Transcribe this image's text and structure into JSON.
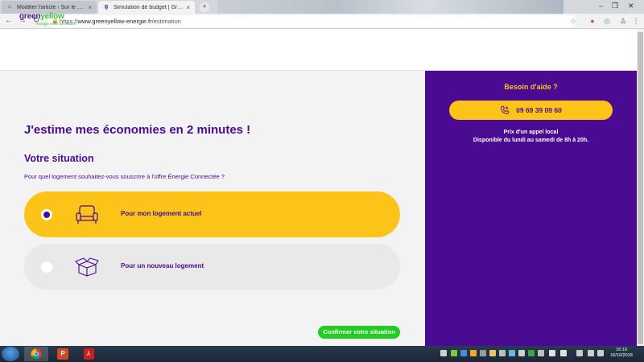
{
  "browser": {
    "tabs": [
      {
        "title": "Modifier l'article ‹ Sur le nuage ...",
        "active": false
      },
      {
        "title": "Simulation de budget | GreenYe...",
        "active": true
      }
    ],
    "url": {
      "scheme": "https://",
      "host": "www.greenyellow-energie.fr",
      "path": "/estimation"
    }
  },
  "site": {
    "logo_part1": "green",
    "logo_part2": "yellow",
    "tagline": "l'énergie entre vos mains"
  },
  "main": {
    "heading": "J'estime mes économies en 2 minutes !",
    "subheading": "Votre situation",
    "question": "Pour quel logement souhaitez-vous souscrire à l'offre Énergie Connectée ?",
    "options": [
      {
        "label": "Pour mon logement actuel",
        "selected": true,
        "icon": "armchair-icon"
      },
      {
        "label": "Pour un nouveau logement",
        "selected": false,
        "icon": "box-icon"
      }
    ],
    "confirm_label": "Confirmer votre situation"
  },
  "help": {
    "title": "Besoin d'aide ?",
    "phone": "09 69 39 09 60",
    "line1": "Prix d'un appel local",
    "line2": "Disponible du lundi au samedi de 8h à 20h."
  },
  "taskbar": {
    "time": "16:10",
    "date": "16/10/2018"
  },
  "colors": {
    "brand_purple": "#4a0a91",
    "brand_yellow": "#fcc419",
    "brand_green": "#22cc22",
    "panel_bg": "#f3f3f3"
  }
}
